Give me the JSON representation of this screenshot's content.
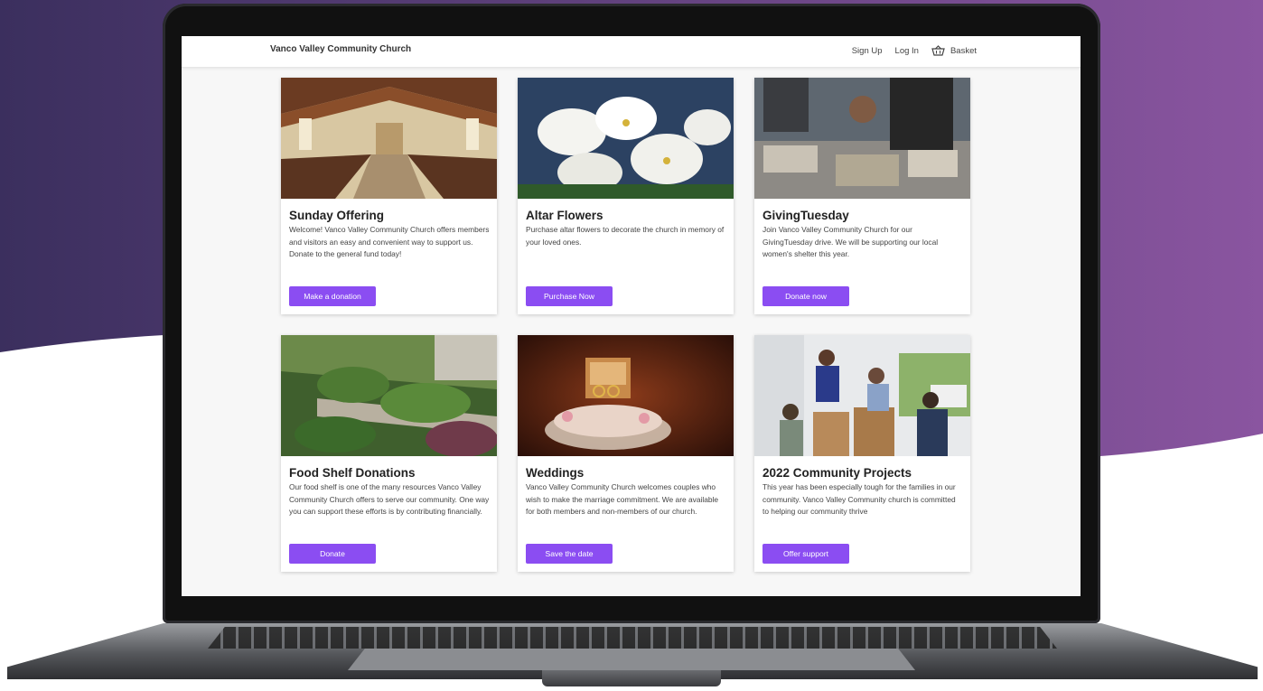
{
  "header": {
    "brand": "Vanco Valley Community Church",
    "sign_up": "Sign Up",
    "log_in": "Log In",
    "basket": "Basket"
  },
  "cards": [
    {
      "title": "Sunday Offering",
      "description": "Welcome! Vanco Valley Community Church offers members and visitors an easy and convenient way to support us. Donate to the general fund today!",
      "button": "Make a donation"
    },
    {
      "title": "Altar Flowers",
      "description": "Purchase altar flowers to decorate the church in memory of your loved ones.",
      "button": "Purchase Now"
    },
    {
      "title": "GivingTuesday",
      "description": "Join Vanco Valley Community Church for our GivingTuesday drive. We will be supporting our local women's shelter this year.",
      "button": "Donate now"
    },
    {
      "title": "Food Shelf Donations",
      "description": "Our food shelf is one of the many resources Vanco Valley Community Church offers to serve our community. One way you can support these efforts is by contributing financially.",
      "button": "Donate"
    },
    {
      "title": "Weddings",
      "description": "Vanco Valley Community Church welcomes couples who wish to make the marriage commitment. We are available for both members and non-members of our church.",
      "button": "Save the date"
    },
    {
      "title": "2022 Community Projects",
      "description": "This year has been especially tough for the families in our community. Vanco Valley Community church is committed to helping our community thrive",
      "button": "Offer support"
    }
  ],
  "colors": {
    "accent": "#8b4df2",
    "background_purple_dark": "#3b2f5e",
    "background_purple_light": "#7f4d9b"
  },
  "icons": {
    "basket": "basket-icon"
  }
}
